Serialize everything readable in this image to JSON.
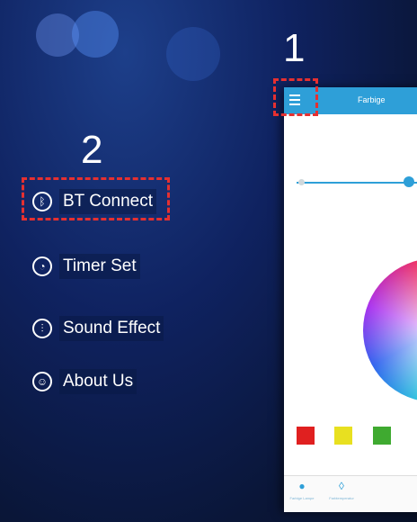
{
  "steps": {
    "step1": "1",
    "step2": "2"
  },
  "app": {
    "title": "Farbige"
  },
  "menu": {
    "items": [
      {
        "label": "BT Connect",
        "icon": "bluetooth-icon"
      },
      {
        "label": "Timer Set",
        "icon": "clock-icon"
      },
      {
        "label": "Sound Effect",
        "icon": "equalizer-icon"
      },
      {
        "label": "About Us",
        "icon": "user-icon"
      }
    ]
  },
  "swatches": {
    "colors": [
      "#e02020",
      "#e8e020",
      "#3faa30"
    ]
  },
  "bottom_nav": {
    "tab1_label": "Farbige Lampe",
    "tab2_label": "Farbtemperatur"
  },
  "colors": {
    "accent": "#2e9fd8",
    "highlight": "#e53030"
  }
}
